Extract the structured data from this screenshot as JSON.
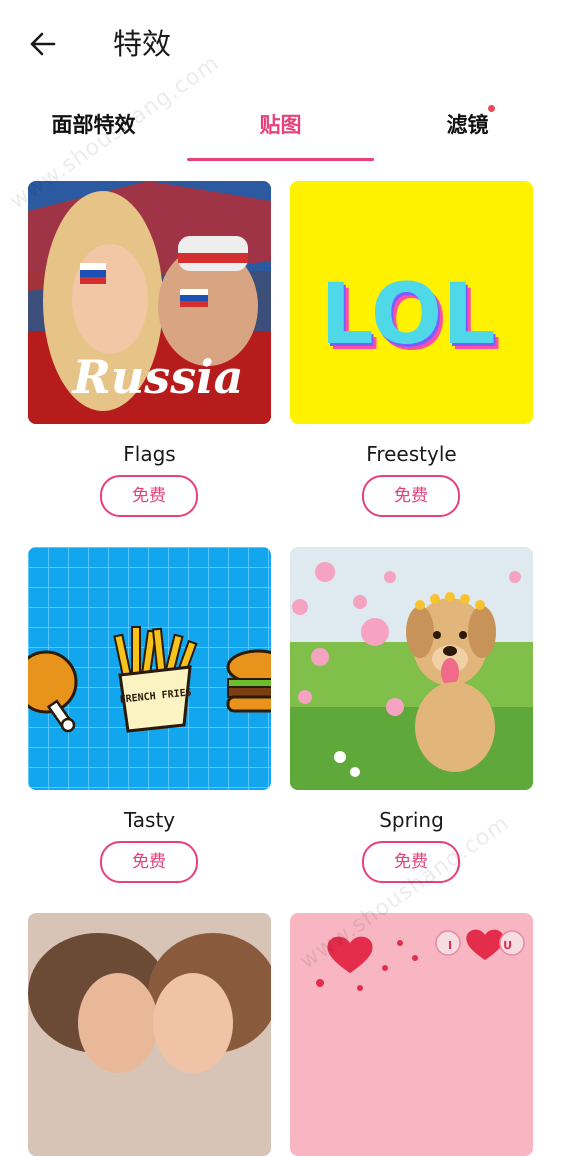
{
  "header": {
    "title": "特效"
  },
  "tabs": [
    {
      "label": "面部特效"
    },
    {
      "label": "贴图"
    },
    {
      "label": "滤镜"
    }
  ],
  "cards": [
    {
      "name": "Flags",
      "button": "免费",
      "image_text": "Russia"
    },
    {
      "name": "Freestyle",
      "button": "免费",
      "image_text": "LOL"
    },
    {
      "name": "Tasty",
      "button": "免费",
      "image_text": "FRENCH FRIES"
    },
    {
      "name": "Spring",
      "button": "免费"
    },
    {
      "name": ""
    },
    {
      "name": "",
      "image_text": "I U"
    }
  ],
  "watermark": "www.shoushang.com",
  "colors": {
    "accent": "#e8407a",
    "badge": "#e84a5c"
  }
}
